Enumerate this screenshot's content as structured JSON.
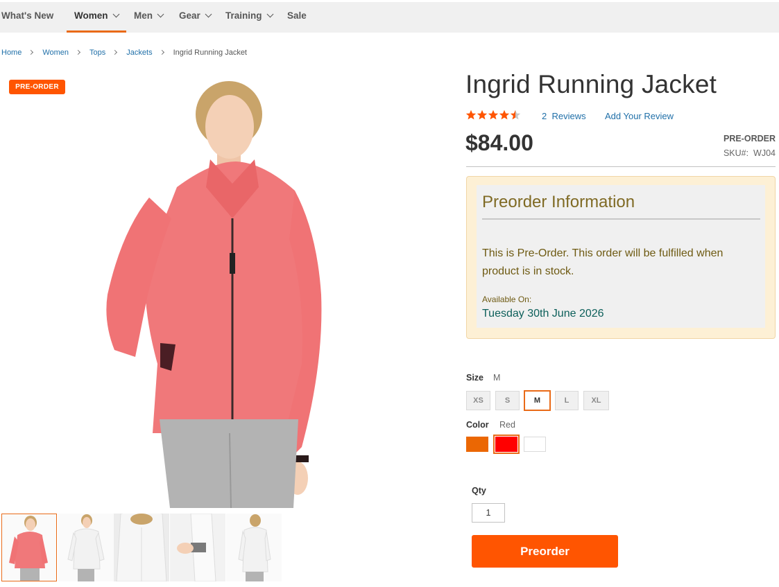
{
  "nav": {
    "items": [
      {
        "label": "What's New",
        "has_dropdown": false,
        "active": false
      },
      {
        "label": "Women",
        "has_dropdown": true,
        "active": true
      },
      {
        "label": "Men",
        "has_dropdown": true,
        "active": false
      },
      {
        "label": "Gear",
        "has_dropdown": true,
        "active": false
      },
      {
        "label": "Training",
        "has_dropdown": true,
        "active": false
      },
      {
        "label": "Sale",
        "has_dropdown": false,
        "active": false
      }
    ]
  },
  "breadcrumb": {
    "items": [
      "Home",
      "Women",
      "Tops",
      "Jackets"
    ],
    "current": "Ingrid Running Jacket"
  },
  "gallery": {
    "badge": "PRE-ORDER",
    "thumbnail_count": 5,
    "selected_thumbnail": 1
  },
  "product": {
    "title": "Ingrid Running Jacket",
    "rating_stars": 4.5,
    "reviews_link": "2  Reviews",
    "add_review": "Add Your Review",
    "price": "$84.00",
    "stock_status": "PRE-ORDER",
    "sku_label": "SKU#:",
    "sku": "WJ04"
  },
  "preorder_info": {
    "title": "Preorder Information",
    "message": "This is Pre-Order. This order will be fulfilled when product is in stock.",
    "available_label": "Available On:",
    "available_date": "Tuesday 30th June 2026"
  },
  "options": {
    "size": {
      "label": "Size",
      "selected": "M",
      "values": [
        "XS",
        "S",
        "M",
        "L",
        "XL"
      ]
    },
    "color": {
      "label": "Color",
      "selected": "Red",
      "swatches": [
        {
          "name": "Orange",
          "hex": "#eb6703"
        },
        {
          "name": "Red",
          "hex": "#ff0000"
        },
        {
          "name": "White",
          "hex": "#ffffff"
        }
      ]
    }
  },
  "qty": {
    "label": "Qty",
    "value": "1"
  },
  "cta": {
    "label": "Preorder"
  },
  "colors": {
    "accent": "#ff5501",
    "link": "#1f6fa8",
    "active_underline": "#e96a17"
  }
}
